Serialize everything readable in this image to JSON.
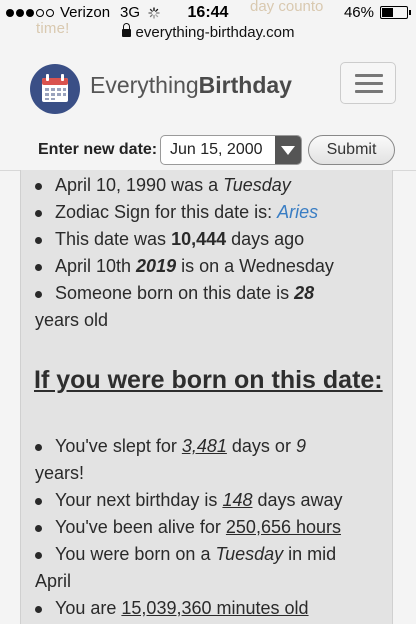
{
  "status_bar": {
    "carrier": "Verizon",
    "network": "3G",
    "time": "16:44",
    "battery_percent": "46%",
    "battery_level": 0.46,
    "signal_bars_filled": 3,
    "signal_bars_total": 5
  },
  "ghost": {
    "line1": "day counto",
    "line2": "time!"
  },
  "url_bar": {
    "url": "everything-birthday.com"
  },
  "header": {
    "brand_light": "Everything",
    "brand_bold": "Birthday",
    "logo_icon": "calendar-icon",
    "menu_icon": "hamburger-icon"
  },
  "date_form": {
    "label": "Enter new date:",
    "selected_date": "Jun 15, 2000",
    "submit_label": "Submit"
  },
  "facts_top": {
    "f1_a": "April 10, 1990 was a ",
    "f1_b": "Tuesday",
    "f2_a": "Zodiac Sign for this date is: ",
    "f2_b": "Aries",
    "f3_a": "This date was ",
    "f3_b": "10,444",
    "f3_c": " days ago",
    "f4_a": "April 10th ",
    "f4_b": "2019",
    "f4_c": " is on a Wednesday",
    "f5_a": "Someone born on this date is ",
    "f5_b": "28",
    "f5_c": "years old"
  },
  "section_heading": "If you were born on this date:",
  "facts_born": {
    "b1_a": "You've slept for ",
    "b1_b": "3,481",
    "b1_c": " days or ",
    "b1_d": "9",
    "b1_e": "years!",
    "b2_a": "Your next birthday is ",
    "b2_b": "148",
    "b2_c": " days away",
    "b3_a": "You've been alive for ",
    "b3_b": "250,656 hours",
    "b4_a": "You were born on a ",
    "b4_b": "Tuesday",
    "b4_c": " in mid",
    "b4_d": "April",
    "b5_a": "You are ",
    "b5_b": "15,039,360 minutes old"
  },
  "colors": {
    "link": "#3a7ec4",
    "logo_bg": "#3a4f86",
    "logo_accent": "#d9534f",
    "content_bg": "#e3e3e3"
  }
}
